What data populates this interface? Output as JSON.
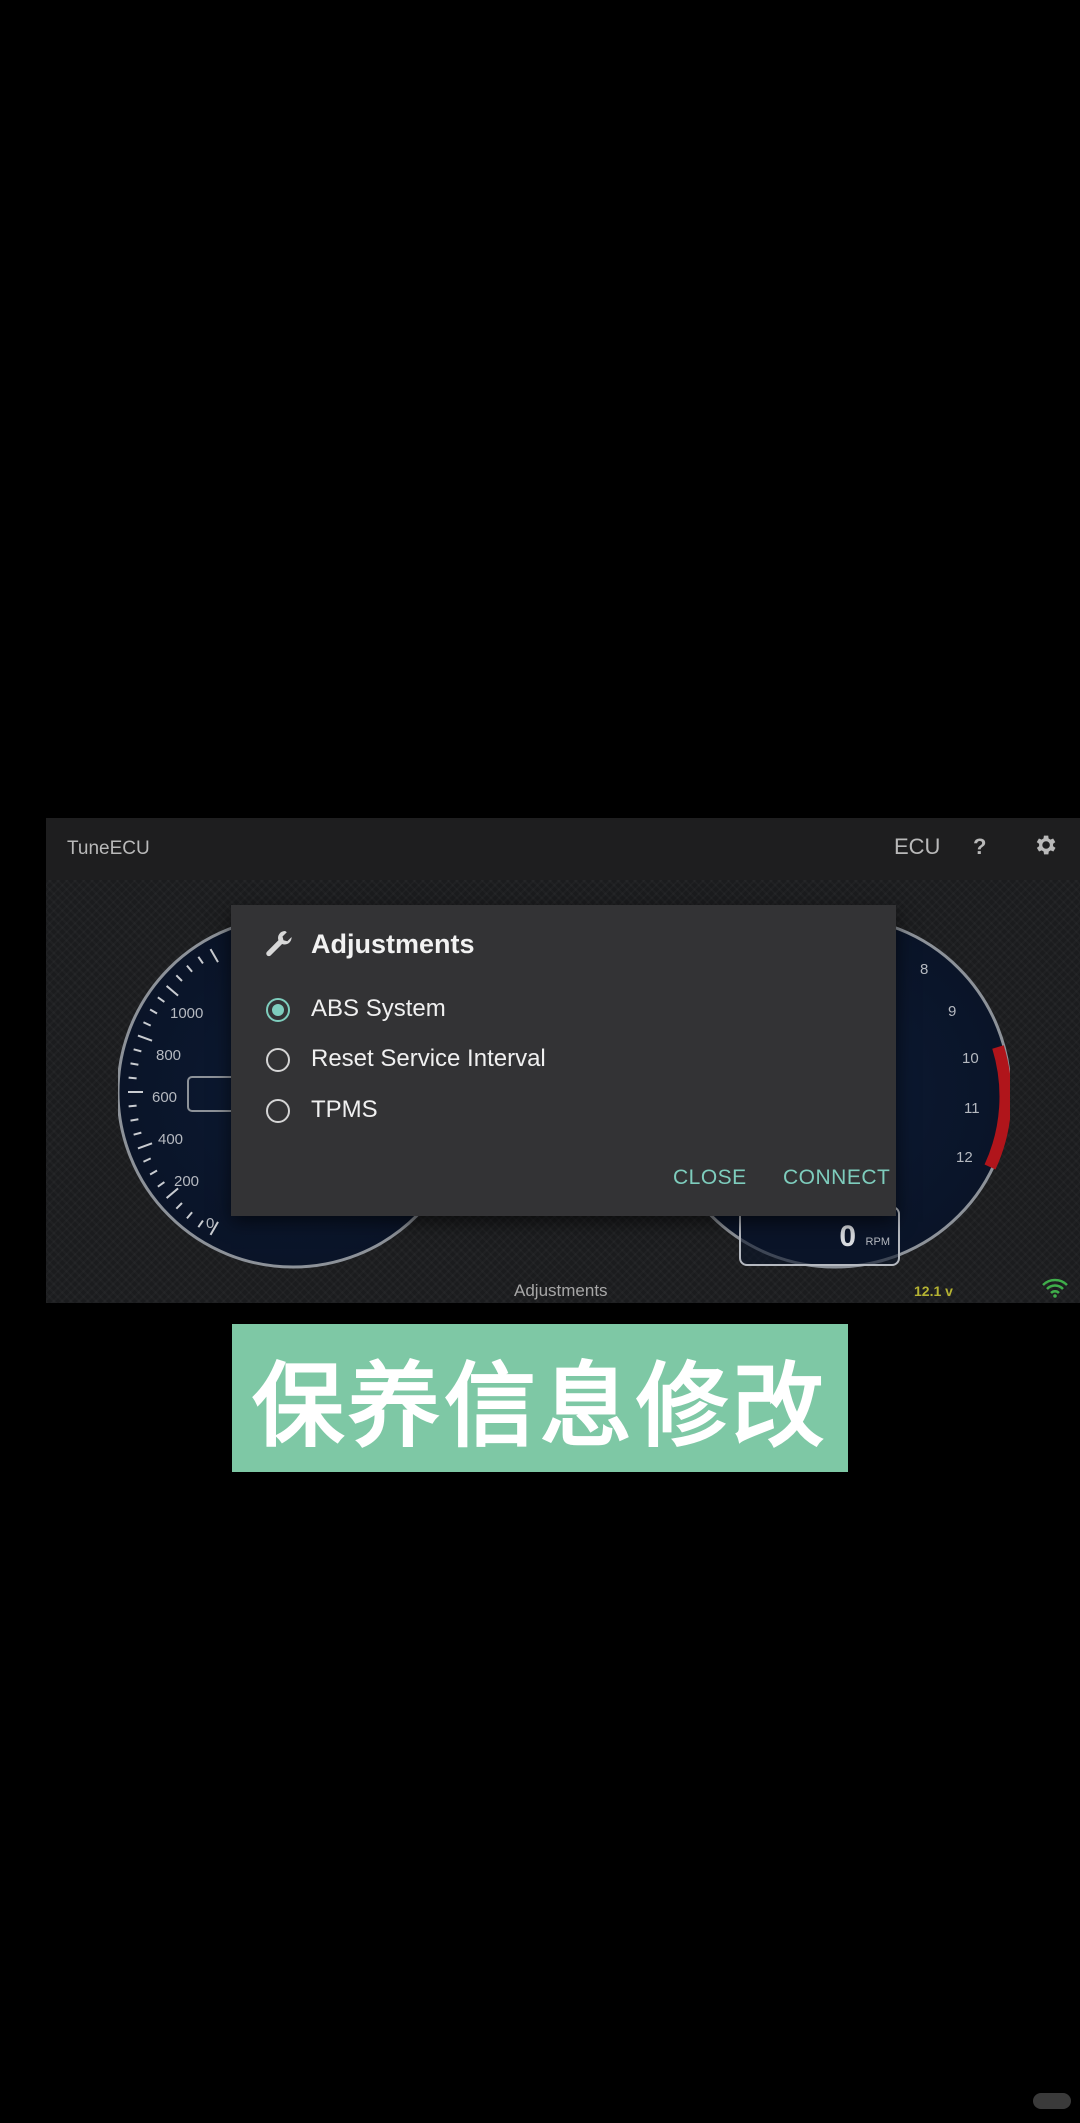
{
  "app": {
    "title": "TuneECU",
    "ecu_label": "ECU",
    "help_label": "?",
    "icons": {
      "settings": "gear-icon",
      "help": "question-icon",
      "signal": "wifi-icon"
    }
  },
  "gauges": {
    "left_ticks": [
      "0",
      "1000",
      "800",
      "600",
      "400",
      "200",
      "0"
    ],
    "right_ticks": [
      "8",
      "9",
      "10",
      "11",
      "12"
    ],
    "rpm_value": "0",
    "rpm_unit": "RPM"
  },
  "status_bar": {
    "screen_label": "Adjustments",
    "voltage": "12.1 v"
  },
  "dialog": {
    "title": "Adjustments",
    "icon": "wrench-icon",
    "options": [
      {
        "label": "ABS System",
        "checked": true
      },
      {
        "label": "Reset Service Interval",
        "checked": false
      },
      {
        "label": "TPMS",
        "checked": false
      }
    ],
    "close_label": "CLOSE",
    "connect_label": "CONNECT",
    "accent_color": "#7ecdbd"
  },
  "caption": {
    "text": "保养信息修改",
    "background": "#7ec8a5"
  }
}
